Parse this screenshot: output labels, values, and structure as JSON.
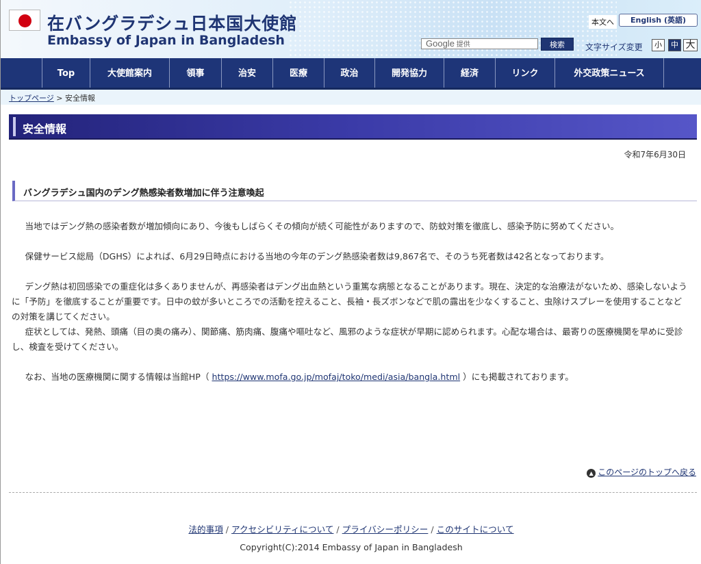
{
  "header": {
    "title_jp": "在バングラデシュ日本国大使館",
    "title_en": "Embassy of Japan in Bangladesh",
    "honbun_label": "本文へ",
    "english_label": "English (英語)",
    "search_provider": "Google",
    "search_placeholder": "提供",
    "search_button": "検索",
    "font_size_label": "文字サイズ変更",
    "font_sizes": [
      "小",
      "中",
      "大"
    ]
  },
  "nav": {
    "items": [
      "Top",
      "大使館案内",
      "領事",
      "治安",
      "医療",
      "政治",
      "開発協力",
      "経済",
      "リンク",
      "外交政策ニュース"
    ]
  },
  "breadcrumb": {
    "home": "トップページ",
    "separator": " > ",
    "current": "安全情報"
  },
  "page": {
    "heading": "安全情報",
    "date": "令和7年6月30日",
    "subheading": "バングラデシュ国内のデング熱感染者数増加に伴う注意喚起",
    "p1": "当地ではデング熱の感染者数が増加傾向にあり、今後もしばらくその傾向が続く可能性がありますので、防蚊対策を徹底し、感染予防に努めてください。",
    "p2": "保健サービス総局（DGHS）によれば、6月29日時点における当地の今年のデング熱感染者数は9,867名で、そのうち死者数は42名となっております。",
    "p3": "デング熱は初回感染での重症化は多くありませんが、再感染者はデング出血熱という重篤な病態となることがあります。現在、決定的な治療法がないため、感染しないように「予防」を徹底することが重要です。日中の蚊が多いところでの活動を控えること、長袖・長ズボンなどで肌の露出を少なくすること、虫除けスプレーを使用することなどの対策を講じてください。",
    "p4": "症状としては、発熱、頭痛（目の奥の痛み）、関節痛、筋肉痛、腹痛や嘔吐など、風邪のような症状が早期に認められます。心配な場合は、最寄りの医療機関を早めに受診し、検査を受けてください。",
    "p5_before": "なお、当地の医療機関に関する情報は当館HP（ ",
    "p5_link": "https://www.mofa.go.jp/mofaj/toko/medi/asia/bangla.html",
    "p5_after": " ）にも掲載されております。"
  },
  "back_to_top": "このページのトップへ戻る",
  "footer": {
    "links": [
      "法的事項",
      "アクセシビリティについて",
      "プライバシーポリシー",
      "このサイトについて"
    ],
    "separator": "/",
    "copyright": "Copyright(C):2014 Embassy of Japan in Bangladesh"
  },
  "colors": {
    "brand_navy": "#1e3578",
    "heading_purple": "#3b3ba8",
    "flag_red": "#d10010"
  },
  "icons": {
    "to_top": "up-arrow-circle-icon"
  }
}
